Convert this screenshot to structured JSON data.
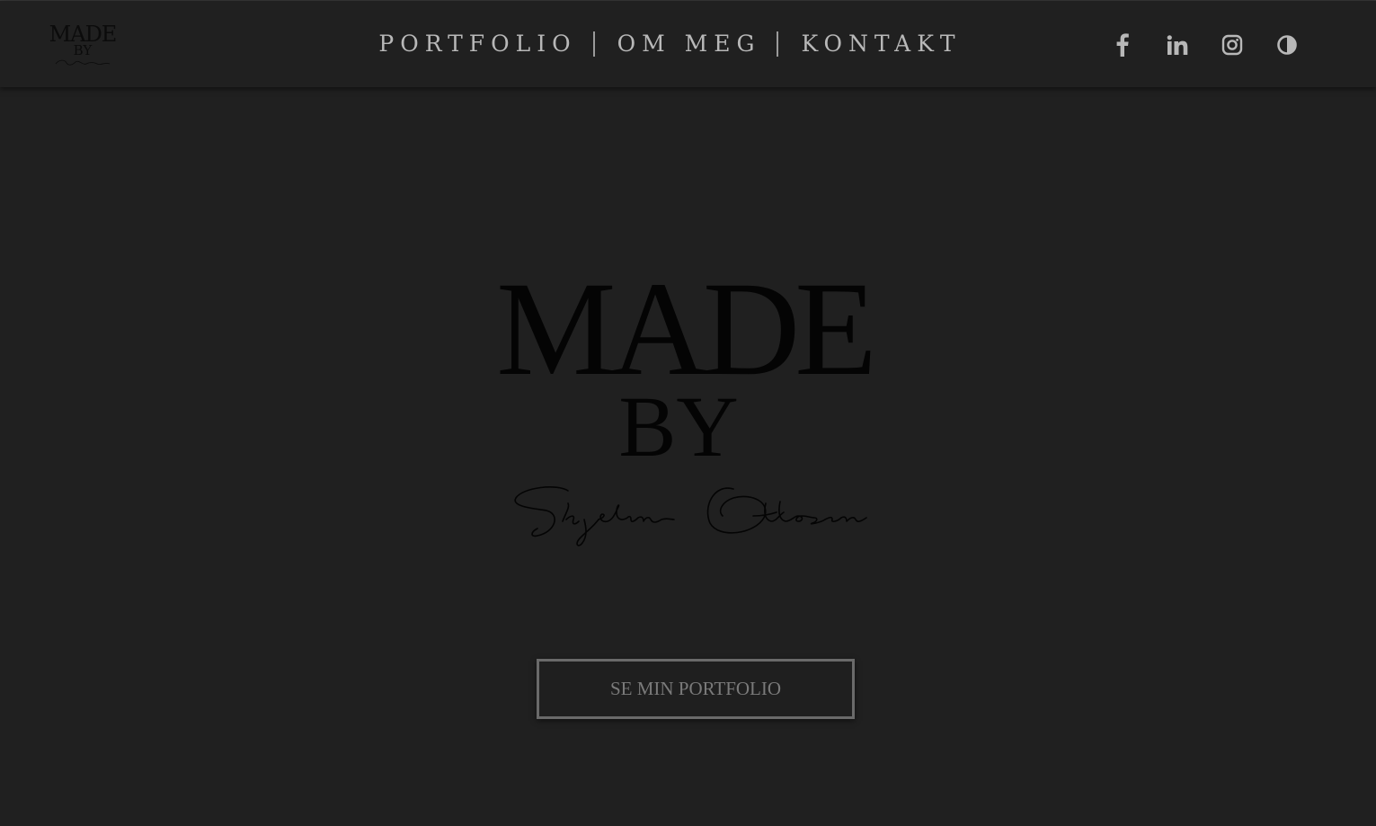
{
  "brand": {
    "logo_line1": "MADE",
    "logo_line2": "BY"
  },
  "nav": {
    "items": [
      {
        "label": "PORTFOLIO"
      },
      {
        "label": "OM MEG"
      },
      {
        "label": "KONTAKT"
      }
    ]
  },
  "social": {
    "icons": [
      {
        "name": "facebook-icon"
      },
      {
        "name": "linkedin-icon"
      },
      {
        "name": "instagram-icon"
      },
      {
        "name": "contrast-toggle-icon"
      }
    ]
  },
  "hero": {
    "line1": "MADE",
    "line2": "BY",
    "signature": "Skjelin Ottosen",
    "cta_label": "SE MIN PORTFOLIO"
  },
  "colors": {
    "background": "#202020",
    "nav_text": "#b8b8b8",
    "logo_ink": "#040404",
    "cta_border": "#6a6a6a",
    "cta_text": "#7a7a7a"
  }
}
